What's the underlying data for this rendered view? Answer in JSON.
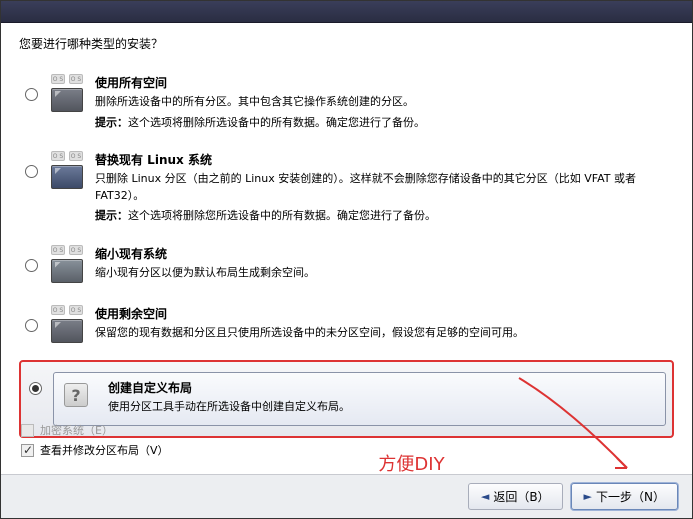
{
  "prompt": "您要进行哪种类型的安装？",
  "options": [
    {
      "id": "use-all",
      "title": "使用所有空间",
      "desc": "删除所选设备中的所有分区。其中包含其它操作系统创建的分区。",
      "warn_prefix": "提示：",
      "warn": "这个选项将删除所选设备中的所有数据。确定您进行了备份。"
    },
    {
      "id": "replace-linux",
      "title": "替换现有 Linux 系统",
      "desc": "只删除 Linux 分区（由之前的 Linux 安装创建的）。这样就不会删除您存储设备中的其它分区（比如 VFAT 或者 FAT32）。",
      "warn_prefix": "提示：",
      "warn": "这个选项将删除您所选设备中的所有数据。确定您进行了备份。"
    },
    {
      "id": "shrink",
      "title": "缩小现有系统",
      "desc": "缩小现有分区以便为默认布局生成剩余空间。",
      "warn_prefix": "",
      "warn": ""
    },
    {
      "id": "use-free",
      "title": "使用剩余空间",
      "desc": "保留您的现有数据和分区且只使用所选设备中的未分区空间，假设您有足够的空间可用。",
      "warn_prefix": "",
      "warn": ""
    },
    {
      "id": "custom",
      "title": "创建自定义布局",
      "desc": "使用分区工具手动在所选设备中创建自定义布局。",
      "warn_prefix": "",
      "warn": ""
    }
  ],
  "diy_note": "方便DIY",
  "checks": {
    "encrypt": "加密系统（E）",
    "review": "查看并修改分区布局（V）"
  },
  "buttons": {
    "back": "返回（B）",
    "next": "下一步（N）"
  },
  "icon_os_label": "O S"
}
